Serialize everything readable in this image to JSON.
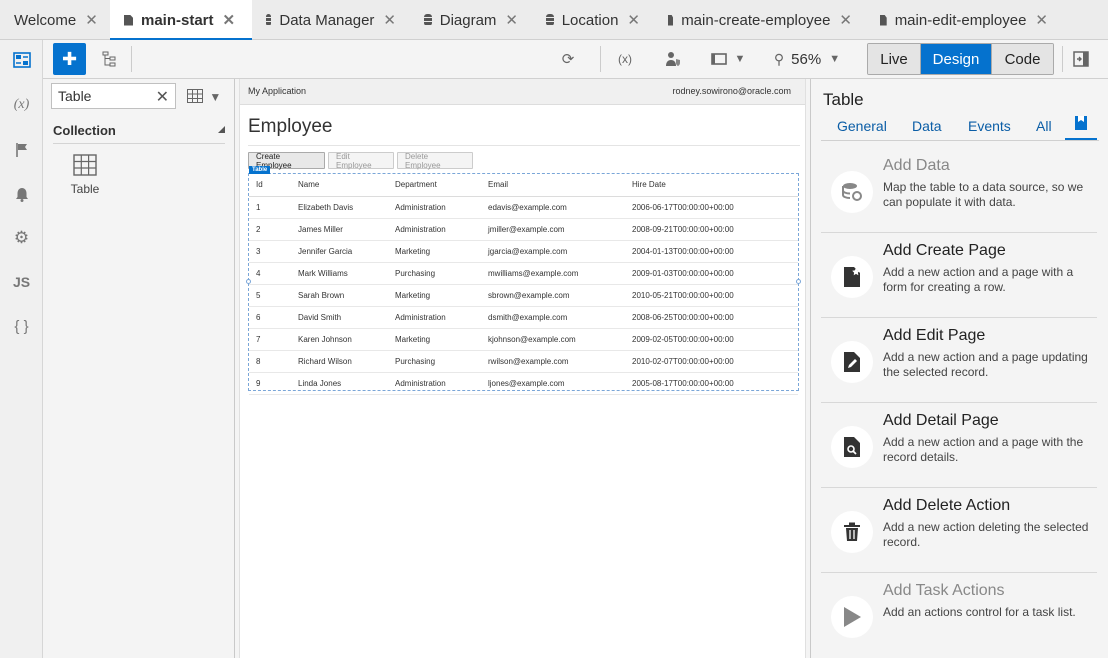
{
  "tabs": [
    {
      "label": "Welcome",
      "icon": "none",
      "active": false
    },
    {
      "label": "main-start",
      "icon": "page-icon",
      "active": true
    },
    {
      "label": "Data Manager",
      "icon": "database-icon",
      "active": false
    },
    {
      "label": "Diagram",
      "icon": "database-icon",
      "active": false
    },
    {
      "label": "Location",
      "icon": "database-icon",
      "active": false
    },
    {
      "label": "main-create-employee",
      "icon": "page-icon",
      "active": false
    },
    {
      "label": "main-edit-employee",
      "icon": "page-icon",
      "active": false
    }
  ],
  "toolbar": {
    "zoom": "56%",
    "modes": [
      "Live",
      "Design",
      "Code"
    ],
    "active_mode": "Design"
  },
  "rail": {
    "items": [
      "page-structure-icon",
      "variables-icon",
      "flag-icon",
      "bell-icon",
      "gear-icon",
      "javascript-icon",
      "json-icon"
    ],
    "variables_glyph": "(x)",
    "js_glyph": "JS",
    "json_glyph": "{ }"
  },
  "components": {
    "search_value": "Table",
    "category": "Collection",
    "items": [
      {
        "label": "Table",
        "icon": "table-icon"
      }
    ]
  },
  "canvas": {
    "app_name": "My Application",
    "user": "rodney.sowirono@oracle.com",
    "page_title": "Employee",
    "buttons": [
      "Create Employee",
      "Edit Employee",
      "Delete Employee"
    ],
    "table_tag": "Table",
    "table": {
      "columns": [
        "Id",
        "Name",
        "Department",
        "Email",
        "Hire Date"
      ],
      "rows": [
        [
          "1",
          "Elizabeth Davis",
          "Administration",
          "edavis@example.com",
          "2006-06-17T00:00:00+00:00"
        ],
        [
          "2",
          "James Miller",
          "Administration",
          "jmiller@example.com",
          "2008-09-21T00:00:00+00:00"
        ],
        [
          "3",
          "Jennifer Garcia",
          "Marketing",
          "jgarcia@example.com",
          "2004-01-13T00:00:00+00:00"
        ],
        [
          "4",
          "Mark Williams",
          "Purchasing",
          "mwilliams@example.com",
          "2009-01-03T00:00:00+00:00"
        ],
        [
          "5",
          "Sarah Brown",
          "Marketing",
          "sbrown@example.com",
          "2010-05-21T00:00:00+00:00"
        ],
        [
          "6",
          "David Smith",
          "Administration",
          "dsmith@example.com",
          "2008-06-25T00:00:00+00:00"
        ],
        [
          "7",
          "Karen Johnson",
          "Marketing",
          "kjohnson@example.com",
          "2009-02-05T00:00:00+00:00"
        ],
        [
          "8",
          "Richard Wilson",
          "Purchasing",
          "rwilson@example.com",
          "2010-02-07T00:00:00+00:00"
        ],
        [
          "9",
          "Linda Jones",
          "Administration",
          "ljones@example.com",
          "2005-08-17T00:00:00+00:00"
        ]
      ]
    }
  },
  "properties": {
    "title": "Table",
    "tabs": [
      "General",
      "Data",
      "Events",
      "All"
    ],
    "quick_starts": [
      {
        "title": "Add Data",
        "desc": "Map the table to a data source, so we can populate it with data.",
        "icon": "database-link-icon",
        "dimmed": true
      },
      {
        "title": "Add Create Page",
        "desc": "Add a new action and a page with a form for creating a row.",
        "icon": "new-page-icon",
        "dimmed": false
      },
      {
        "title": "Add Edit Page",
        "desc": "Add a new action and a page updating the selected record.",
        "icon": "edit-page-icon",
        "dimmed": false
      },
      {
        "title": "Add Detail Page",
        "desc": "Add a new action and a page with the record details.",
        "icon": "detail-page-icon",
        "dimmed": false
      },
      {
        "title": "Add Delete Action",
        "desc": "Add a new action deleting the selected record.",
        "icon": "trash-icon",
        "dimmed": false
      },
      {
        "title": "Add Task Actions",
        "desc": "Add an actions control for a task list.",
        "icon": "play-icon",
        "dimmed": true
      }
    ]
  },
  "colors": {
    "accent": "#0572ce"
  }
}
